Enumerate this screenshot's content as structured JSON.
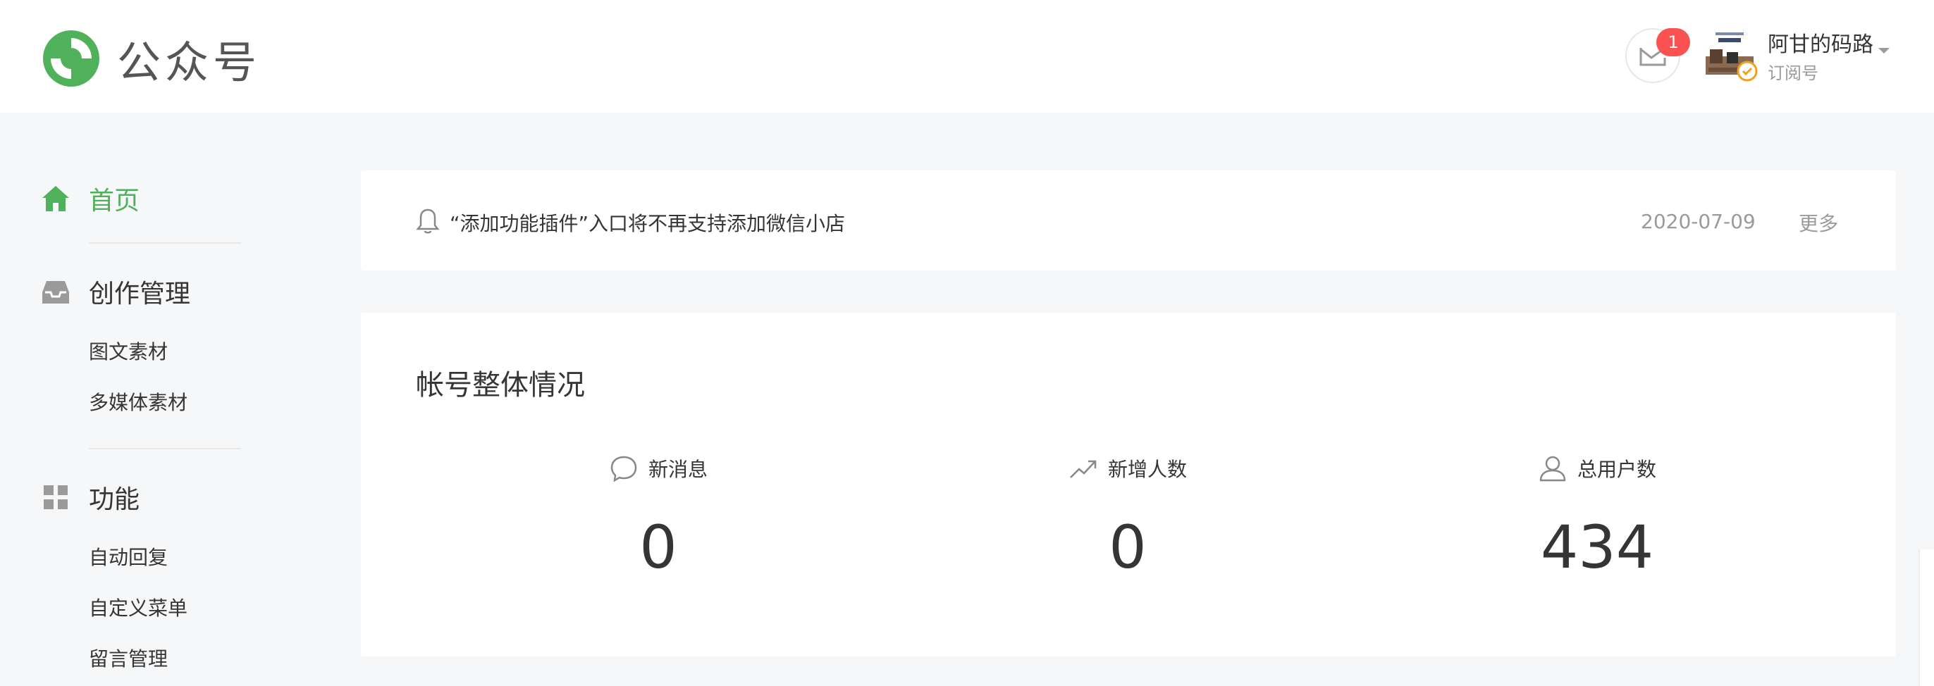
{
  "header": {
    "logo_text": "公众号",
    "mail_badge": "1",
    "account_name": "阿甘的码路",
    "account_type": "订阅号",
    "brand_color": "#4fb25b"
  },
  "sidebar": {
    "home": "首页",
    "creation": {
      "title": "创作管理",
      "items": [
        "图文素材",
        "多媒体素材"
      ]
    },
    "features": {
      "title": "功能",
      "items": [
        "自动回复",
        "自定义菜单",
        "留言管理"
      ]
    }
  },
  "notice": {
    "text": "“添加功能插件”入口将不再支持添加微信小店",
    "date": "2020-07-09",
    "more": "更多"
  },
  "overview": {
    "title": "帐号整体情况",
    "stats": [
      {
        "label": "新消息",
        "value": "0",
        "icon": "message-icon"
      },
      {
        "label": "新增人数",
        "value": "0",
        "icon": "trend-up-icon"
      },
      {
        "label": "总用户数",
        "value": "434",
        "icon": "user-icon"
      }
    ]
  }
}
